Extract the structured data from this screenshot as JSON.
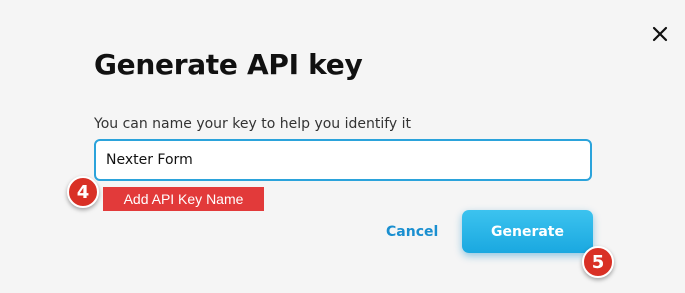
{
  "dialog": {
    "title": "Generate API key",
    "field_label": "You can name your key to help you identify it",
    "key_name_value": "Nexter Form",
    "callout_text": "Add API Key Name",
    "cancel_label": "Cancel",
    "generate_label": "Generate",
    "close_icon": "close-icon"
  },
  "annotations": {
    "step_4": "4",
    "step_5": "5"
  },
  "colors": {
    "accent": "#1aa8e0",
    "input_border": "#2ba3db",
    "callout": "#e23a3a",
    "badge": "#d93025"
  }
}
